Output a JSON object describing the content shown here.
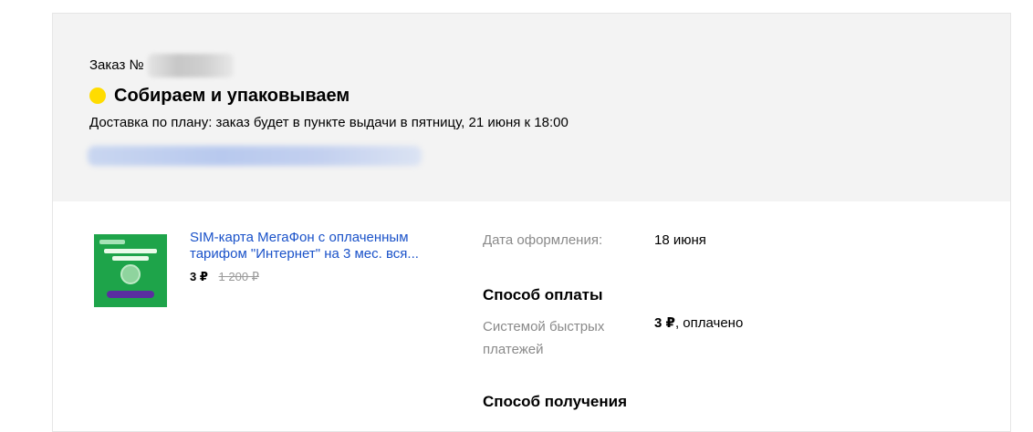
{
  "order": {
    "number_label": "Заказ №",
    "status_text": "Собираем и упаковываем",
    "status_color": "#ffdc00",
    "delivery_plan": "Доставка по плану: заказ будет в пункте выдачи в пятницу, 21 июня к 18:00"
  },
  "product": {
    "title": "SIM-карта МегаФон с оплаченным тарифом \"Интернет\" на 3 мес. вся...",
    "price_now": "3 ₽",
    "price_old": "1 200 ₽",
    "image_icon": "sim-card-product-image"
  },
  "details": {
    "date_label": "Дата оформления:",
    "date_value": "18 июня",
    "payment_heading": "Способ оплаты",
    "payment_method": "Системой быстрых платежей",
    "payment_amount": "3 ₽",
    "payment_status": ", оплачено",
    "receive_heading": "Способ получения"
  },
  "colors": {
    "header_bg": "#f3f3f3",
    "link": "#1a52c9",
    "muted": "#8a8a8a"
  }
}
